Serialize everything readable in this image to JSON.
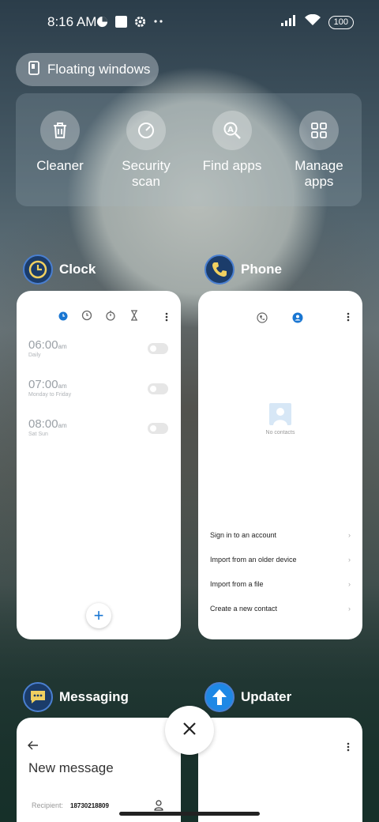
{
  "status_bar": {
    "time": "8:16 AM",
    "battery": "100"
  },
  "floating_windows": {
    "label": "Floating windows"
  },
  "quick_actions": [
    {
      "label": "Cleaner",
      "icon": "trash-icon"
    },
    {
      "label": "Security scan",
      "icon": "security-icon"
    },
    {
      "label": "Find apps",
      "icon": "find-apps-icon"
    },
    {
      "label": "Manage apps",
      "icon": "grid-icon"
    }
  ],
  "apps": {
    "clock": {
      "name": "Clock",
      "alarms": [
        {
          "time": "06:00",
          "ampm": "am",
          "sub": "Daily"
        },
        {
          "time": "07:00",
          "ampm": "am",
          "sub": "Monday to Friday"
        },
        {
          "time": "08:00",
          "ampm": "am",
          "sub": "Sat Sun"
        }
      ],
      "add_label": "+"
    },
    "phone": {
      "name": "Phone",
      "empty_text": "No contacts",
      "options": [
        "Sign in to an account",
        "Import from an older device",
        "Import from a file",
        "Create a new contact"
      ]
    },
    "messaging": {
      "name": "Messaging",
      "title": "New message",
      "recipient_label": "Recipient:",
      "recipient_value": "18730218809"
    },
    "updater": {
      "name": "Updater"
    }
  },
  "colors": {
    "accent": "#1976d2",
    "card": "#ffffff"
  }
}
